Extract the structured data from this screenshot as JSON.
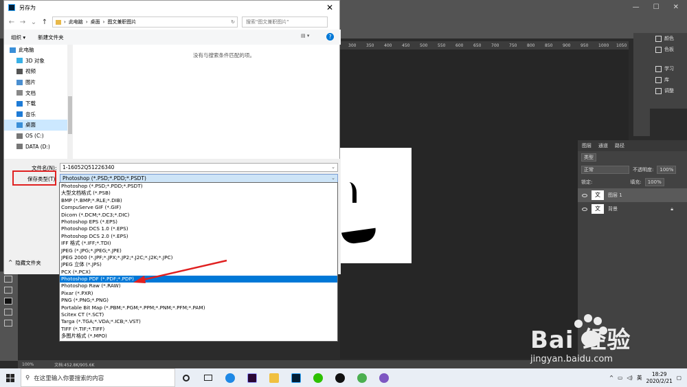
{
  "dialog": {
    "title": "另存为",
    "close": "✕",
    "address": [
      "此电脑",
      "桌面",
      "图文兼职图片"
    ],
    "search_placeholder": "搜索\"图文兼职图片\"",
    "organize": "组织 ▾",
    "new_folder": "新建文件夹",
    "empty_message": "没有与搜索条件匹配的项。",
    "nav": [
      {
        "label": "此电脑",
        "icon": "computer-icon",
        "color": "#3a8fd8"
      },
      {
        "label": "3D 对象",
        "icon": "cube-icon",
        "color": "#39b0e6"
      },
      {
        "label": "视频",
        "icon": "video-icon",
        "color": "#555"
      },
      {
        "label": "图片",
        "icon": "picture-icon",
        "color": "#4b8fd0"
      },
      {
        "label": "文档",
        "icon": "document-icon",
        "color": "#888"
      },
      {
        "label": "下载",
        "icon": "download-icon",
        "color": "#1e7bd6"
      },
      {
        "label": "音乐",
        "icon": "music-icon",
        "color": "#1e7bd6"
      },
      {
        "label": "桌面",
        "icon": "desktop-icon",
        "color": "#3a8fd8",
        "selected": true
      },
      {
        "label": "OS (C:)",
        "icon": "drive-icon",
        "color": "#777"
      },
      {
        "label": "DATA (D:)",
        "icon": "drive-icon",
        "color": "#777"
      }
    ],
    "filename_label": "文件名(N):",
    "filename_value": "1-16052Q51226340",
    "filetype_label": "保存类型(T):",
    "filetype_value": "Photoshop (*.PSD;*.PDD;*.PSDT)",
    "hide_folders": "隐藏文件夹",
    "options": [
      "Photoshop (*.PSD;*.PDD;*.PSDT)",
      "大型文档格式 (*.PSB)",
      "BMP (*.BMP;*.RLE;*.DIB)",
      "CompuServe GIF (*.GIF)",
      "Dicom (*.DCM;*.DC3;*.DIC)",
      "Photoshop EPS (*.EPS)",
      "Photoshop DCS 1.0 (*.EPS)",
      "Photoshop DCS 2.0 (*.EPS)",
      "IFF 格式 (*.IFF;*.TDI)",
      "JPEG (*.JPG;*.JPEG;*.JPE)",
      "JPEG 2000 (*.JPF;*.JPX;*.JP2;*.J2C;*.J2K;*.JPC)",
      "JPEG 立体 (*.JPS)",
      "PCX (*.PCX)",
      "Photoshop PDF (*.PDF;*.PDP)",
      "Photoshop Raw (*.RAW)",
      "Pixar (*.PXR)",
      "PNG (*.PNG;*.PNG)",
      "Portable Bit Map (*.PBM;*.PGM;*.PPM;*.PNM;*.PFM;*.PAM)",
      "Scitex CT (*.SCT)",
      "Targa (*.TGA;*.VDA;*.ICB;*.VST)",
      "TIFF (*.TIF;*.TIFF)",
      "多图片格式 (*.MPO)"
    ],
    "highlighted_option": 13
  },
  "ps": {
    "ruler_ticks": [
      "300",
      "350",
      "400",
      "450",
      "500",
      "550",
      "600",
      "650",
      "700",
      "750",
      "800",
      "850",
      "900",
      "950",
      "1000",
      "1050"
    ],
    "right_panel": [
      "颜色",
      "色板",
      "学习",
      "库",
      "调整"
    ],
    "layers_tabs": [
      "图层",
      "通道",
      "路径"
    ],
    "layers_filter": "类型",
    "blend_mode": "正常",
    "opacity_label": "不透明度:",
    "opacity_value": "100%",
    "lock_label": "锁定:",
    "fill_label": "填充:",
    "fill_value": "100%",
    "layers": [
      {
        "name": "图层 1",
        "thumb": "文",
        "active": true
      },
      {
        "name": "背景",
        "thumb": "文",
        "active": false
      }
    ],
    "zoom": "100%",
    "doc_info": "文档:452.8K/905.6K"
  },
  "taskbar": {
    "search_placeholder": "在这里输入你要搜索的内容",
    "ime": "英",
    "time": "18:29",
    "date": "2020/2/21"
  },
  "watermark": {
    "brand": "Bai  经验",
    "url": "jingyan.baidu.com"
  }
}
